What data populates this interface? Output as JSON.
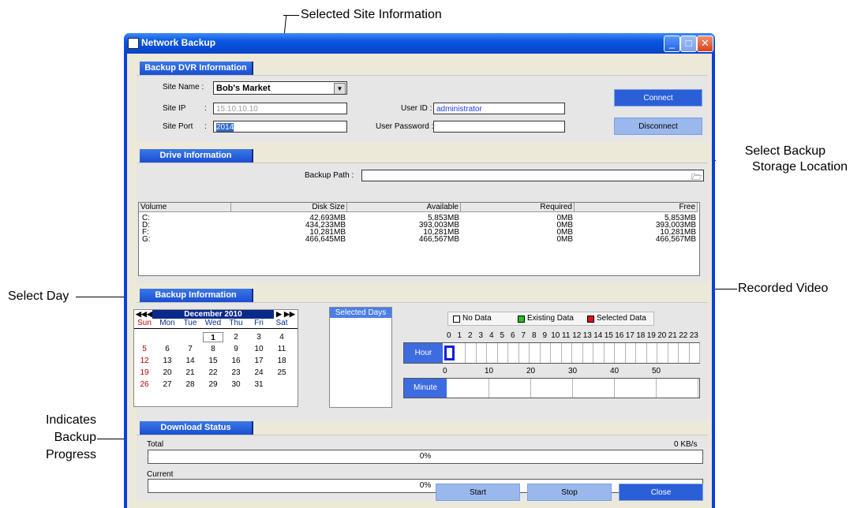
{
  "callouts": {
    "selected_site": "Selected Site Information",
    "select_storage_line1": "Select Backup",
    "select_storage_line2": "Storage Location",
    "select_day": "Select Day",
    "recorded_video": "Recorded Video",
    "progress_line1": "Indicates",
    "progress_line2": "Backup",
    "progress_line3": "Progress"
  },
  "window": {
    "title": "Network Backup"
  },
  "dvr": {
    "header": "Backup DVR Information",
    "site_name_label": "Site Name :",
    "site_name_value": "Bob's Market",
    "site_ip_label": "Site IP",
    "colon": ":",
    "site_ip_value": "15.10.10.10",
    "site_port_label": "Site Port",
    "site_port_value": "2014",
    "user_id_label": "User ID :",
    "user_id_value": "administrator",
    "user_password_label": "User Password :",
    "user_password_value": "",
    "connect": "Connect",
    "disconnect": "Disconnect"
  },
  "drive": {
    "header": "Drive Information",
    "backup_path_label": "Backup Path :",
    "backup_path_value": "",
    "columns": [
      "Volume",
      "Disk Size",
      "Available",
      "Required",
      "Free"
    ],
    "rows": [
      [
        "C:",
        "42,693MB",
        "5,853MB",
        "0MB",
        "5,853MB"
      ],
      [
        "D:",
        "434,233MB",
        "393,003MB",
        "0MB",
        "393,003MB"
      ],
      [
        "F:",
        "10,281MB",
        "10,281MB",
        "0MB",
        "10,281MB"
      ],
      [
        "G:",
        "466,645MB",
        "466,567MB",
        "0MB",
        "466,567MB"
      ]
    ]
  },
  "backup": {
    "header": "Backup Information",
    "calendar": {
      "month": "December 2010",
      "prev_year": "◀◀",
      "prev_month": "◀",
      "next_month": "▶",
      "next_year": "▶▶",
      "weekdays": [
        "Sun",
        "Mon",
        "Tue",
        "Wed",
        "Thu",
        "Fri",
        "Sat"
      ],
      "weeks": [
        [
          "",
          "",
          "",
          "1",
          "2",
          "3",
          "4"
        ],
        [
          "5",
          "6",
          "7",
          "8",
          "9",
          "10",
          "11"
        ],
        [
          "12",
          "13",
          "14",
          "15",
          "16",
          "17",
          "18"
        ],
        [
          "19",
          "20",
          "21",
          "22",
          "23",
          "24",
          "25"
        ],
        [
          "26",
          "27",
          "28",
          "29",
          "30",
          "31",
          ""
        ]
      ],
      "selected_day": "1"
    },
    "selected_days_label": "Selected Days",
    "legend": {
      "no_data": "No Data",
      "existing_data": "Existing Data",
      "selected_data": "Selected Data",
      "no_data_color": "#ffffff",
      "existing_color": "#22c422",
      "selected_color": "#e01414"
    },
    "hour_label": "Hour",
    "minute_label": "Minute",
    "hours": [
      "0",
      "1",
      "2",
      "3",
      "4",
      "5",
      "6",
      "7",
      "8",
      "9",
      "10",
      "11",
      "12",
      "13",
      "14",
      "15",
      "16",
      "17",
      "18",
      "19",
      "20",
      "21",
      "22",
      "23"
    ],
    "minute_ticks": [
      "0",
      "10",
      "20",
      "30",
      "40",
      "50"
    ]
  },
  "download": {
    "header": "Download Status",
    "total_label": "Total",
    "speed": "0 KB/s",
    "total_percent": "0%",
    "current_label": "Current",
    "current_percent": "0%"
  },
  "buttons": {
    "start": "Start",
    "stop": "Stop",
    "close": "Close"
  },
  "colors": {
    "titlebar": "#0a55e0",
    "section_header": "#1a4fd0",
    "accent": "#2a5fd8"
  }
}
